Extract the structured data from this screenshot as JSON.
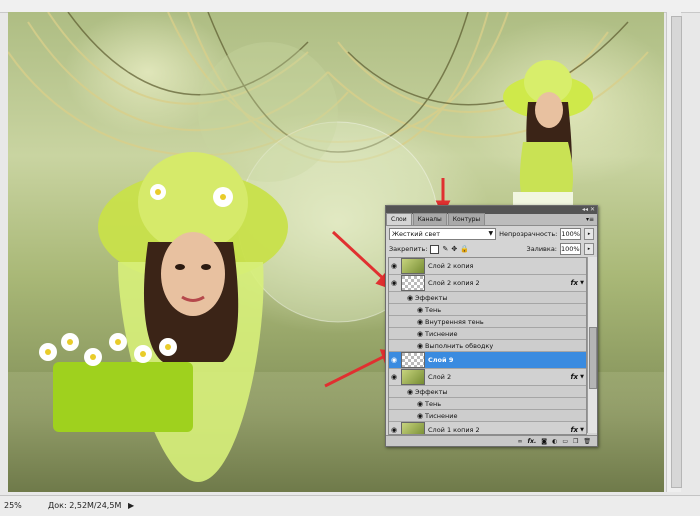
{
  "status": {
    "zoom": "25%",
    "doc_label": "Док: 2,52M/24,5M",
    "nav_arrow": "▶"
  },
  "layers_panel": {
    "tabs": [
      {
        "label": "Слои",
        "active": true
      },
      {
        "label": "Каналы",
        "active": false
      },
      {
        "label": "Контуры",
        "active": false
      }
    ],
    "blend_mode": "Жесткий свет",
    "opacity_label": "Непрозрачность:",
    "opacity_value": "100%",
    "lock_label": "Закрепить:",
    "fill_label": "Заливка:",
    "fill_value": "100%",
    "layers": [
      {
        "name": "Слой 2 копия",
        "kind": "layer"
      },
      {
        "name": "Слой 2 копия 2",
        "kind": "layer",
        "fx": "fx"
      },
      {
        "name": "Эффекты",
        "kind": "effects-group"
      },
      {
        "name": "Тень",
        "kind": "effect"
      },
      {
        "name": "Внутренняя тень",
        "kind": "effect"
      },
      {
        "name": "Тиснение",
        "kind": "effect"
      },
      {
        "name": "Выполнить обводку",
        "kind": "effect"
      },
      {
        "name": "Слой 9",
        "kind": "layer",
        "selected": true
      },
      {
        "name": "Слой 2",
        "kind": "layer",
        "fx": "fx"
      },
      {
        "name": "Эффекты",
        "kind": "effects-group"
      },
      {
        "name": "Тень",
        "kind": "effect"
      },
      {
        "name": "Тиснение",
        "kind": "effect"
      },
      {
        "name": "Слой 1 копия 2",
        "kind": "layer",
        "fx": "fx"
      }
    ],
    "bottom_icons": [
      "link-icon",
      "fx-icon",
      "mask-icon",
      "adjustment-icon",
      "folder-icon",
      "new-layer-icon",
      "trash-icon"
    ]
  },
  "colors": {
    "selection": "#3a8be0",
    "arrow": "#e03030"
  }
}
